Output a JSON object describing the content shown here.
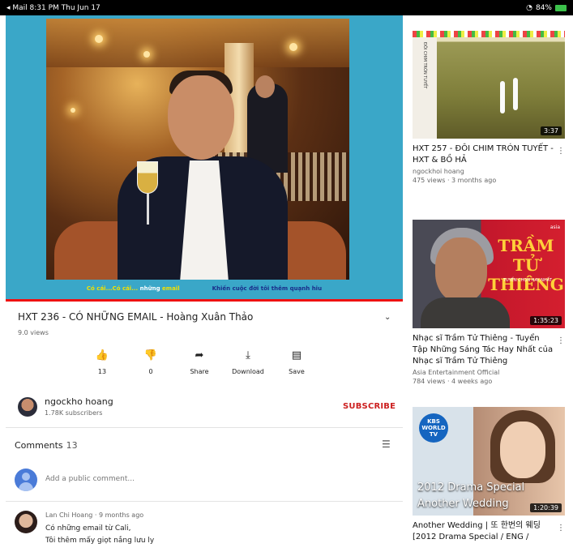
{
  "status_bar": {
    "time": "◂ Mail  8:31 PM  Thu Jun 17",
    "battery": "84%"
  },
  "player": {
    "caption_left_a": "Có cái...Có cái...",
    "caption_left_b": "những",
    "caption_left_c": "email",
    "caption_right": "Khiến cuộc đời tôi thêm quạnh hiu"
  },
  "video": {
    "title": "HXT 236 - CÓ NHỮNG EMAIL - Hoàng Xuân Thảo",
    "views": "9.0 views",
    "expand_icon": "chevron-down"
  },
  "actions": [
    {
      "name": "like",
      "icon": "👍",
      "label": "13"
    },
    {
      "name": "dislike",
      "icon": "👎",
      "label": "0"
    },
    {
      "name": "share",
      "icon": "➦",
      "label": "Share"
    },
    {
      "name": "download",
      "icon": "⤓",
      "label": "Download"
    },
    {
      "name": "save",
      "icon": "▤",
      "label": "Save"
    }
  ],
  "channel": {
    "name": "ngockho hoang",
    "subscribers": "1.78K subscribers",
    "subscribe_label": "SUBSCRIBE"
  },
  "comments": {
    "header": "Comments",
    "count": "13",
    "add_placeholder": "Add a public comment...",
    "first": {
      "meta": "Lan Chi Hoang · 9 months ago",
      "line1": "Có những email từ Cali,",
      "line2": "Tôi thêm mấy giọt nắng lưu ly"
    }
  },
  "recommendations": [
    {
      "title": "HXT 257 - ĐÔI CHIM TRÓN TUYẾT - HXT & BỒ HẢ",
      "channel": "ngockhoi hoang",
      "meta": "475 views · 3 months ago",
      "duration": "3:37"
    },
    {
      "title": "Nhạc sĩ Trầm Tử Thiêng - Tuyển Tập Những Sáng Tác Hay Nhất của Nhạc sĩ Trầm Tử Thiêng",
      "channel": "Asia Entertainment Official",
      "meta": "784 views · 4 weeks ago",
      "duration": "1:35:23",
      "thumb_title": "TRẦM TỬ THIÊNG",
      "thumb_sub": "TUYỂN CHỌN HAY NHẤT",
      "thumb_logo": "asia"
    },
    {
      "title": "Another Wedding | 또 한번의 웨딩 [2012 Drama Special / ENG /",
      "channel": "",
      "meta": "",
      "duration": "1:20:39",
      "thumb_line1": "2012 Drama Special",
      "thumb_line2": "Another Wedding",
      "thumb_logo": "KBS WORLD TV"
    }
  ]
}
